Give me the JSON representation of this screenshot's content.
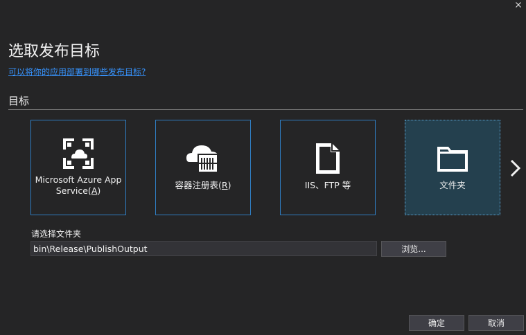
{
  "window": {
    "close_glyph": "×"
  },
  "header": {
    "title": "选取发布目标",
    "help_link": "可以将你的应用部署到哪些发布目标?"
  },
  "section": {
    "label": "目标"
  },
  "targets": [
    {
      "label_line1": "Microsoft Azure App",
      "label_line2_prefix": "Service(",
      "label_line2_mnemonic": "A",
      "label_line2_suffix": ")",
      "icon": "azure-app-service-icon",
      "selected": false
    },
    {
      "label_prefix": "容器注册表(",
      "label_mnemonic": "R",
      "label_suffix": ")",
      "icon": "container-registry-icon",
      "selected": false
    },
    {
      "label": "IIS、FTP 等",
      "icon": "document-icon",
      "selected": false
    },
    {
      "label": "文件夹",
      "icon": "folder-icon",
      "selected": true
    }
  ],
  "folder": {
    "label": "请选择文件夹",
    "path_value": "bin\\Release\\PublishOutput",
    "browse_label": "浏览..."
  },
  "footer": {
    "ok_label": "确定",
    "cancel_label": "取消"
  },
  "colors": {
    "background": "#252526",
    "link": "#3794ff",
    "tile_border": "#2f7dc2",
    "selected_tile": "#24404e"
  }
}
